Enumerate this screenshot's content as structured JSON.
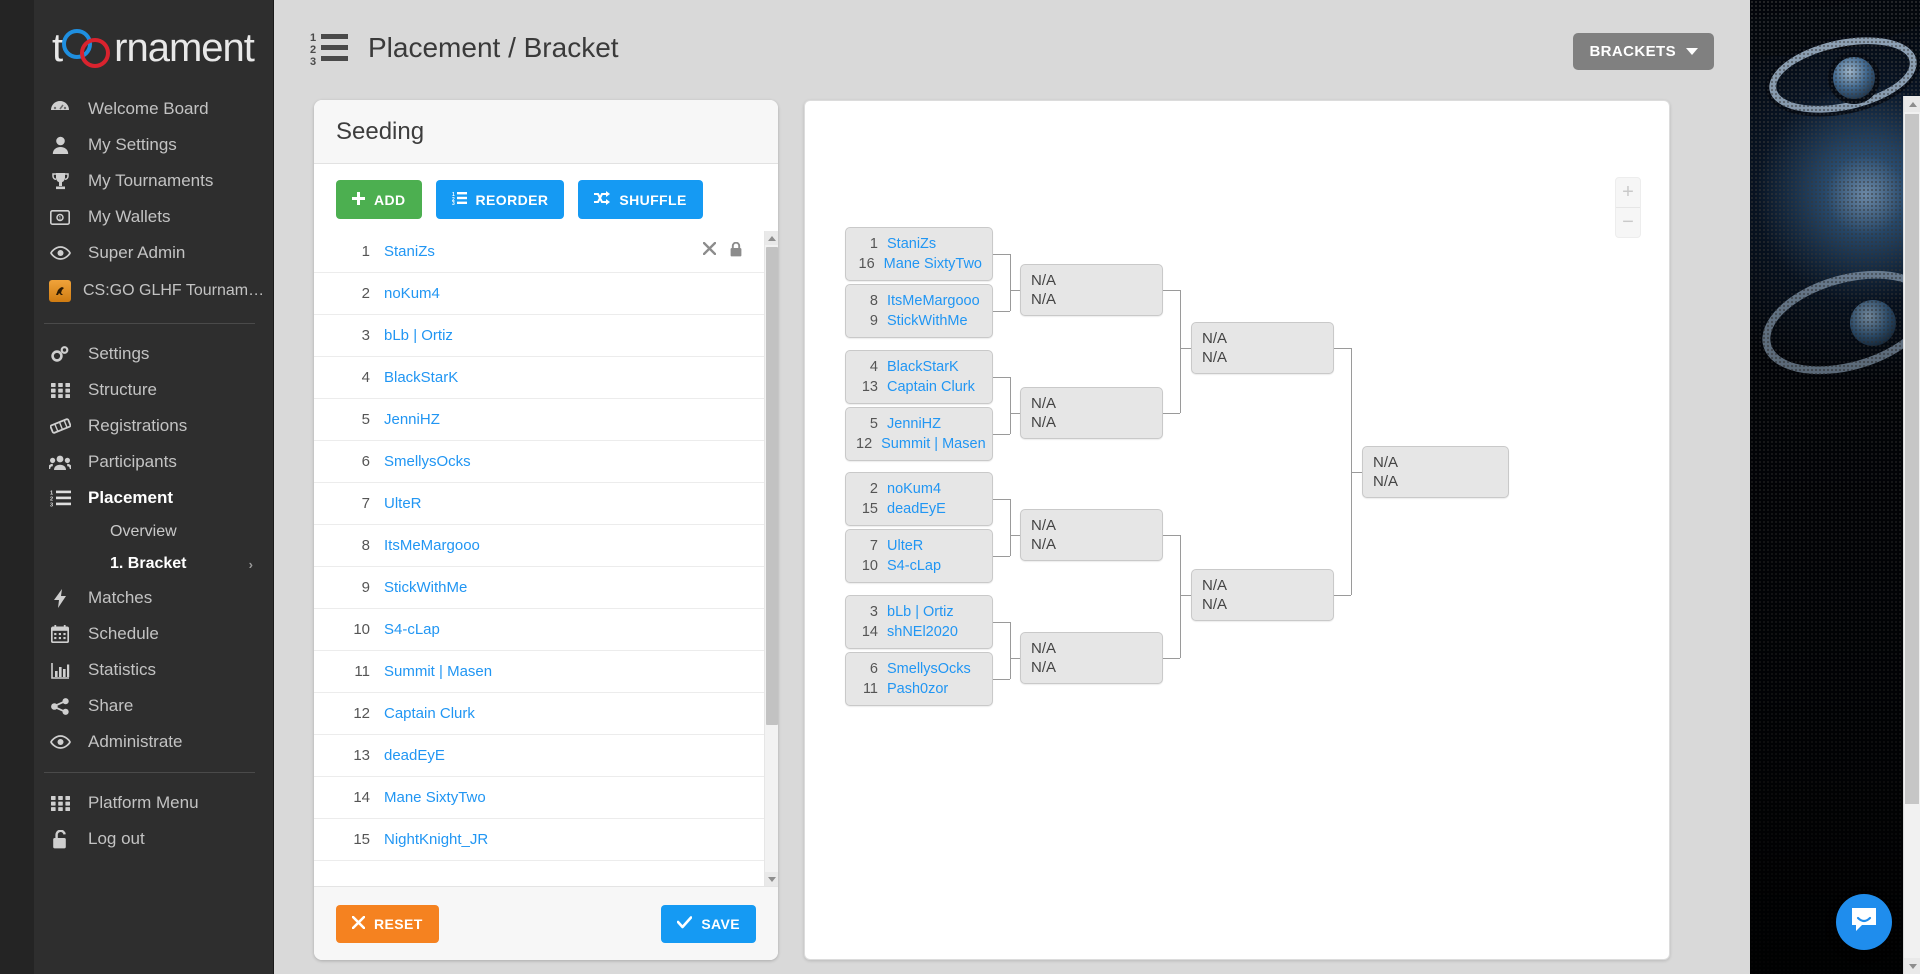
{
  "brand": {
    "name": "toornament"
  },
  "sidebar": {
    "main_items": [
      {
        "label": "Welcome Board",
        "icon": "dashboard-icon"
      },
      {
        "label": "My Settings",
        "icon": "user-icon"
      },
      {
        "label": "My Tournaments",
        "icon": "trophy-icon"
      },
      {
        "label": "My Wallets",
        "icon": "wallet-icon"
      },
      {
        "label": "Super Admin",
        "icon": "eye-icon"
      }
    ],
    "tournament": {
      "label": "CS:GO GLHF Tournamen...",
      "icon": "csgo-icon"
    },
    "tournament_items": [
      {
        "label": "Settings",
        "icon": "gears-icon",
        "active": false
      },
      {
        "label": "Structure",
        "icon": "grid-icon",
        "active": false
      },
      {
        "label": "Registrations",
        "icon": "ticket-icon",
        "active": false
      },
      {
        "label": "Participants",
        "icon": "users-icon",
        "active": false
      },
      {
        "label": "Placement",
        "icon": "numbered-list-icon",
        "active": true
      }
    ],
    "placement_sub": [
      {
        "label": "Overview",
        "active": false,
        "chevron": ""
      },
      {
        "label": "1. Bracket",
        "active": true,
        "chevron": "›"
      }
    ],
    "tournament_items_after": [
      {
        "label": "Matches",
        "icon": "bolt-icon"
      },
      {
        "label": "Schedule",
        "icon": "calendar-icon"
      },
      {
        "label": "Statistics",
        "icon": "bar-chart-icon"
      },
      {
        "label": "Share",
        "icon": "share-icon"
      },
      {
        "label": "Administrate",
        "icon": "eye-icon"
      }
    ],
    "footer_items": [
      {
        "label": "Platform Menu",
        "icon": "grid-icon"
      },
      {
        "label": "Log out",
        "icon": "unlock-icon"
      }
    ]
  },
  "topbar": {
    "title": "Placement / Bracket",
    "title_icon": "numbered-list-icon",
    "brackets_button": "BRACKETS"
  },
  "seeding": {
    "title": "Seeding",
    "buttons": {
      "add": "ADD",
      "reorder": "REORDER",
      "shuffle": "SHUFFLE"
    },
    "footer": {
      "reset": "RESET",
      "save": "SAVE"
    },
    "participants": [
      {
        "rank": "1",
        "name": "StaniZs",
        "actions": true
      },
      {
        "rank": "2",
        "name": "noKum4",
        "actions": false
      },
      {
        "rank": "3",
        "name": "bLb | Ortiz",
        "actions": false
      },
      {
        "rank": "4",
        "name": "BlackStarK",
        "actions": false
      },
      {
        "rank": "5",
        "name": "JenniHZ",
        "actions": false
      },
      {
        "rank": "6",
        "name": "SmellysOcks",
        "actions": false
      },
      {
        "rank": "7",
        "name": "UlteR",
        "actions": false
      },
      {
        "rank": "8",
        "name": "ItsMeMargooo",
        "actions": false
      },
      {
        "rank": "9",
        "name": "StickWithMe",
        "actions": false
      },
      {
        "rank": "10",
        "name": "S4-cLap",
        "actions": false
      },
      {
        "rank": "11",
        "name": "Summit | Masen",
        "actions": false
      },
      {
        "rank": "12",
        "name": "Captain Clurk",
        "actions": false
      },
      {
        "rank": "13",
        "name": "deadEyE",
        "actions": false
      },
      {
        "rank": "14",
        "name": "Mane SixtyTwo",
        "actions": false
      },
      {
        "rank": "15",
        "name": "NightKnight_JR",
        "actions": false
      }
    ]
  },
  "bracket": {
    "na_label": "N/A",
    "zoom_in": "+",
    "zoom_out": "−",
    "round1": [
      {
        "top": {
          "seed": "1",
          "name": "StaniZs"
        },
        "bottom": {
          "seed": "16",
          "name": "Mane SixtyTwo"
        }
      },
      {
        "top": {
          "seed": "8",
          "name": "ItsMeMargooo"
        },
        "bottom": {
          "seed": "9",
          "name": "StickWithMe"
        }
      },
      {
        "top": {
          "seed": "4",
          "name": "BlackStarK"
        },
        "bottom": {
          "seed": "13",
          "name": "Captain Clurk"
        }
      },
      {
        "top": {
          "seed": "5",
          "name": "JenniHZ"
        },
        "bottom": {
          "seed": "12",
          "name": "Summit | Masen"
        }
      },
      {
        "top": {
          "seed": "2",
          "name": "noKum4"
        },
        "bottom": {
          "seed": "15",
          "name": "deadEyE"
        }
      },
      {
        "top": {
          "seed": "7",
          "name": "UlteR"
        },
        "bottom": {
          "seed": "10",
          "name": "S4-cLap"
        }
      },
      {
        "top": {
          "seed": "3",
          "name": "bLb | Ortiz"
        },
        "bottom": {
          "seed": "14",
          "name": "shNEl2020"
        }
      },
      {
        "top": {
          "seed": "6",
          "name": "SmellysOcks"
        },
        "bottom": {
          "seed": "11",
          "name": "Pash0zor"
        }
      }
    ],
    "round2": [
      {
        "top": "N/A",
        "bottom": "N/A"
      },
      {
        "top": "N/A",
        "bottom": "N/A"
      },
      {
        "top": "N/A",
        "bottom": "N/A"
      },
      {
        "top": "N/A",
        "bottom": "N/A"
      }
    ],
    "round3": [
      {
        "top": "N/A",
        "bottom": "N/A"
      },
      {
        "top": "N/A",
        "bottom": "N/A"
      }
    ],
    "round4": [
      {
        "top": "N/A",
        "bottom": "N/A"
      }
    ]
  },
  "colors": {
    "accent_blue": "#2196f3",
    "green": "#4caf50",
    "orange": "#f58220",
    "sidebar_bg": "#2e2e2e",
    "content_bg": "#d9d9d9"
  },
  "intercom": {
    "icon": "chat-bubble-icon"
  }
}
